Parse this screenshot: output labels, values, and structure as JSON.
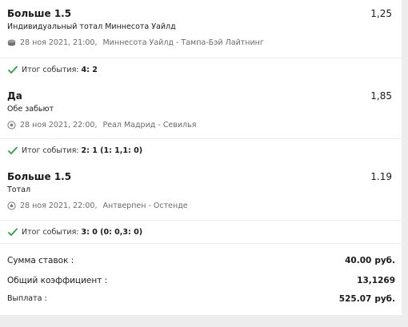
{
  "bets": [
    {
      "title": "Больше 1.5",
      "odds": "1,25",
      "market": "Индивидуальный тотал Миннесота Уайлд",
      "sport_icon": "hockey-puck-icon",
      "date": "28 ноя 2021, 21:00,",
      "event": "Миннесота Уайлд - Тампа-Бэй Лайтнинг",
      "result_label": "Итог события:",
      "result_score": "4: 2"
    },
    {
      "title": "Да",
      "odds": "1,85",
      "market": "Обе забьют",
      "sport_icon": "soccer-ball-icon",
      "date": "28 ноя 2021, 22:00,",
      "event": "Реал Мадрид - Севилья",
      "result_label": "Итог события:",
      "result_score": "2: 1 (1: 1,1: 0)"
    },
    {
      "title": "Больше 1.5",
      "odds": "1.19",
      "market": "Тотал",
      "sport_icon": "soccer-ball-icon",
      "date": "28 ноя 2021, 22:00,",
      "event": "Антверпен - Остенде",
      "result_label": "Итог события:",
      "result_score": "3: 0 (0: 0,3: 0)"
    }
  ],
  "summary": {
    "stake_label": "Сумма ставок :",
    "stake_value": "40.00",
    "stake_currency": "руб.",
    "coef_label": "Общий коэффициент :",
    "coef_value": "13,1269",
    "payout_label": "Выплата :",
    "payout_value": "525.07",
    "payout_currency": "руб."
  },
  "colors": {
    "check": "#2e9e3e",
    "muted": "#6a6a6a"
  }
}
